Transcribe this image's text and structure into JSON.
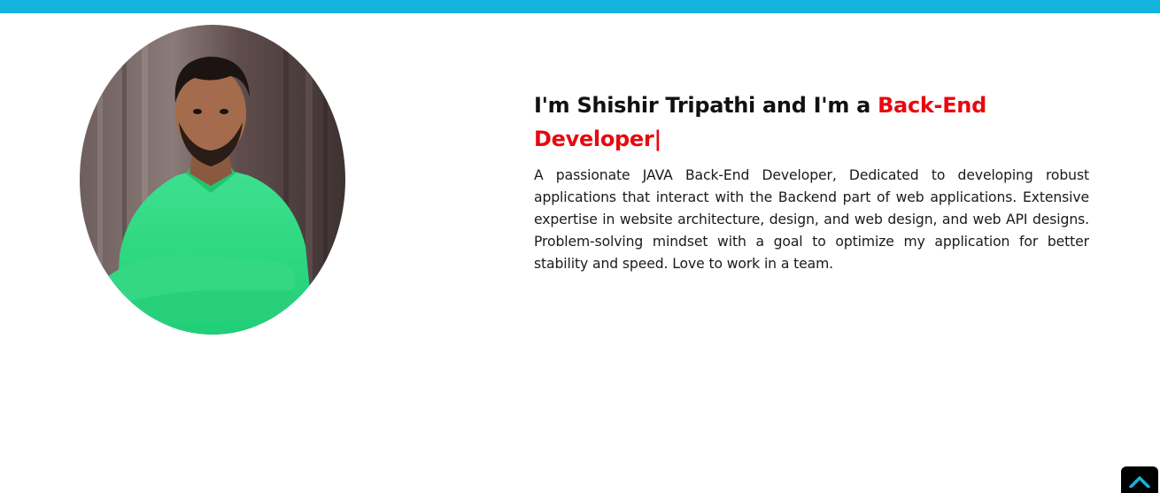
{
  "colors": {
    "top_bar": "#14b4de",
    "accent_red": "#e8080f",
    "text": "#111111",
    "back_to_top_bg": "#000000",
    "back_to_top_icon": "#14b4de"
  },
  "profile": {
    "image_alt": "Profile photo of Shishir Tripathi"
  },
  "about": {
    "headline_prefix": "I'm Shishir Tripathi and I'm a ",
    "role": "Back-End Developer",
    "cursor": "|",
    "description": "A passionate JAVA Back-End Developer, Dedicated to developing robust applications that interact with the Backend part of web applications. Extensive expertise in website architecture, design, and web design, and web API designs. Problem-solving mindset with a goal to optimize my application for better stability and speed. Love to work in a team."
  },
  "back_to_top": {
    "icon": "chevron-up-icon"
  }
}
